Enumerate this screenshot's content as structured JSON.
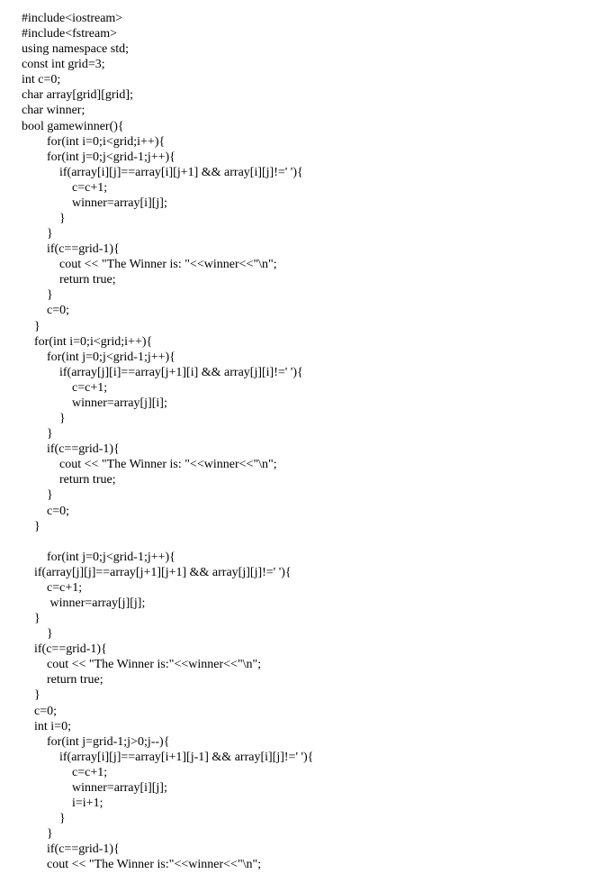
{
  "code": {
    "lines": [
      "#include<iostream>",
      "#include<fstream>",
      "using namespace std;",
      "const int grid=3;",
      "int c=0;",
      "char array[grid][grid];",
      "char winner;",
      "bool gamewinner(){",
      "        for(int i=0;i<grid;i++){",
      "        for(int j=0;j<grid-1;j++){",
      "            if(array[i][j]==array[i][j+1] && array[i][j]!=' '){",
      "                c=c+1;",
      "                winner=array[i][j];",
      "            }",
      "        }",
      "        if(c==grid-1){",
      "            cout << \"The Winner is: \"<<winner<<\"\\n\";",
      "            return true;",
      "        }",
      "        c=0;",
      "    }",
      "    for(int i=0;i<grid;i++){",
      "        for(int j=0;j<grid-1;j++){",
      "            if(array[j][i]==array[j+1][i] && array[j][i]!=' '){",
      "                c=c+1;",
      "                winner=array[j][i];",
      "            }",
      "        }",
      "        if(c==grid-1){",
      "            cout << \"The Winner is: \"<<winner<<\"\\n\";",
      "            return true;",
      "        }",
      "        c=0;",
      "    }",
      "",
      "        for(int j=0;j<grid-1;j++){",
      "    if(array[j][j]==array[j+1][j+1] && array[j][j]!=' '){",
      "        c=c+1;",
      "         winner=array[j][j];",
      "    }",
      "        }",
      "    if(c==grid-1){",
      "        cout << \"The Winner is:\"<<winner<<\"\\n\";",
      "        return true;",
      "    }",
      "    c=0;",
      "    int i=0;",
      "        for(int j=grid-1;j>0;j--){",
      "            if(array[i][j]==array[i+1][j-1] && array[i][j]!=' '){",
      "                c=c+1;",
      "                winner=array[i][j];",
      "                i=i+1;",
      "            }",
      "        }",
      "        if(c==grid-1){",
      "        cout << \"The Winner is:\"<<winner<<\"\\n\";"
    ]
  }
}
